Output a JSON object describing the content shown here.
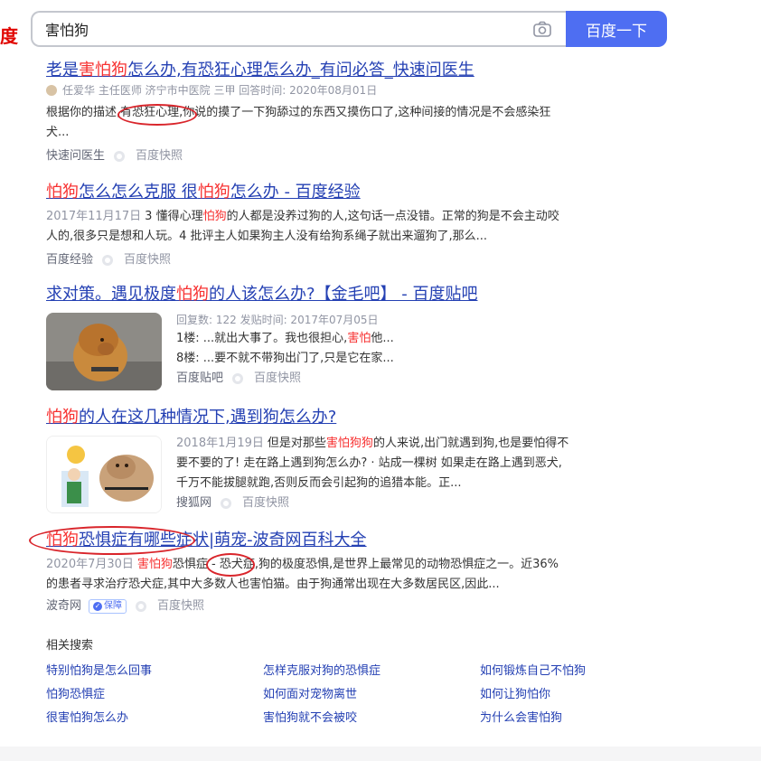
{
  "search": {
    "query": "害怕狗",
    "button_label": "百度一下",
    "logo_fragment": "度"
  },
  "results": [
    {
      "title_parts": [
        "老是",
        "害怕狗",
        "怎么办,有恐狂心理怎么办_有问必答_快速问医生"
      ],
      "meta": "任爱华 主任医师 济宁市中医院 三甲 回答时间: 2020年08月01日",
      "abstract_parts": [
        "根据你的描述,",
        "有恐狂心理",
        ",你说的摸了一下狗舔过的东西又摸伤口了,这种间接的情况是不会感染狂犬..."
      ],
      "source": "快速问医生",
      "snapshot": "百度快照"
    },
    {
      "title_parts": [
        "怕狗",
        "怎么怎么克服 很",
        "怕狗",
        "怎么办 - 百度经验"
      ],
      "date": "2017年11月17日",
      "abstract_parts": [
        "3 懂得心理",
        "怕狗",
        "的人都是没养过狗的人,这句话一点没错。正常的狗是不会主动咬人的,很多只是想和人玩。4 批评主人如果狗主人没有给狗系绳子就出来遛狗了,那么..."
      ],
      "source": "百度经验",
      "snapshot": "百度快照"
    },
    {
      "title_parts": [
        "求对策。遇见极度",
        "怕狗",
        "的人该怎么办?【金毛吧】 - 百度贴吧"
      ],
      "meta": "回复数: 122 发贴时间: 2017年07月05日",
      "floor1_parts": [
        "1楼: ...就出大事了。我也很担心,",
        "害怕",
        "他..."
      ],
      "floor8": "8楼: ...要不就不带狗出门了,只是它在家...",
      "source": "百度贴吧",
      "snapshot": "百度快照"
    },
    {
      "title_parts": [
        "怕狗",
        "的人在这几种情况下,遇到狗怎么办?"
      ],
      "date": "2018年1月19日",
      "abstract_parts": [
        "但是对那些",
        "害怕狗狗",
        "的人来说,出门就遇到狗,也是要怕得不要不要的了! 走在路上遇到狗怎么办? · 站成一棵树 如果走在路上遇到恶犬,千万不能拔腿就跑,否则反而会引起狗的追猎本能。正..."
      ],
      "source": "搜狐网",
      "snapshot": "百度快照"
    },
    {
      "title_parts": [
        "怕狗",
        "恐惧症有哪些症状|萌宠-波奇网百科大全"
      ],
      "date": "2020年7月30日",
      "abstract_parts": [
        "害怕狗",
        "恐惧症 - 恐犬症,狗的极度恐惧,是世界上最常见的动物恐惧症之一。近36%的患者寻求治疗恐犬症,其中大多数人也害怕猫。由于狗通常出现在大多数居民区,因此..."
      ],
      "source": "波奇网",
      "badge": "保障",
      "snapshot": "百度快照"
    }
  ],
  "related": {
    "title": "相关搜索",
    "items": [
      "特别怕狗是怎么回事",
      "怎样克服对狗的恐惧症",
      "如何锻炼自己不怕狗",
      "怕狗恐惧症",
      "如何面对宠物离世",
      "如何让狗怕你",
      "很害怕狗怎么办",
      "害怕狗就不会被咬",
      "为什么会害怕狗"
    ]
  },
  "colors": {
    "accent": "#4e6ef2",
    "link": "#2440b3",
    "highlight": "#f73131",
    "annotation": "#d9252b"
  }
}
